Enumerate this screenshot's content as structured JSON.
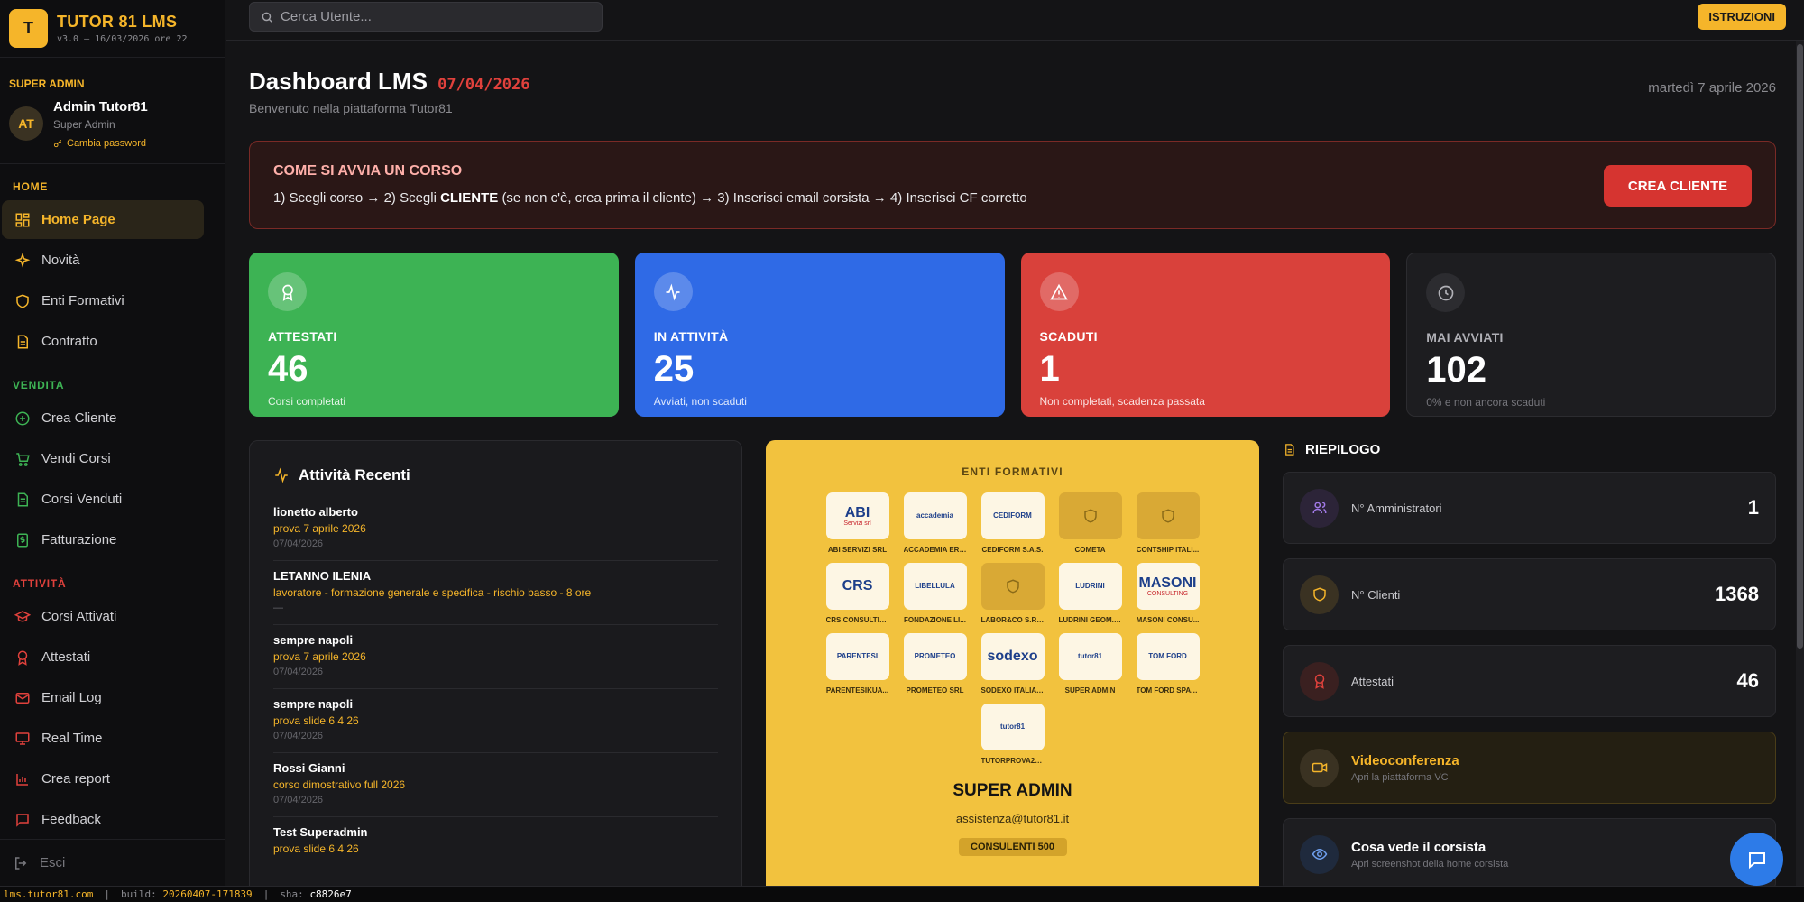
{
  "brand": {
    "logo_letter": "T",
    "name": "TUTOR 81 LMS",
    "version": "v3.0 — 16/03/2026 ore 22"
  },
  "user": {
    "role_heading": "SUPER ADMIN",
    "initials": "AT",
    "name": "Admin Tutor81",
    "role": "Super Admin",
    "change_password": "Cambia password"
  },
  "sidebar": {
    "sections": [
      {
        "label": "HOME",
        "color": "#f5b52a"
      },
      {
        "label": "VENDITA",
        "color": "#3db354"
      },
      {
        "label": "ATTIVITÀ",
        "color": "#e0413c"
      }
    ],
    "home_items": [
      {
        "label": "Home Page",
        "icon": "grid-icon"
      },
      {
        "label": "Novità",
        "icon": "sparkles-icon"
      },
      {
        "label": "Enti Formativi",
        "icon": "shield-icon"
      },
      {
        "label": "Contratto",
        "icon": "document-icon"
      }
    ],
    "vendita_items": [
      {
        "label": "Crea Cliente",
        "icon": "plus-circle-icon"
      },
      {
        "label": "Vendi Corsi",
        "icon": "cart-icon"
      },
      {
        "label": "Corsi Venduti",
        "icon": "sheet-icon"
      },
      {
        "label": "Fatturazione",
        "icon": "dollar-icon"
      }
    ],
    "attivita_items": [
      {
        "label": "Corsi Attivati",
        "icon": "graduation-cap-icon"
      },
      {
        "label": "Attestati",
        "icon": "award-icon"
      },
      {
        "label": "Email Log",
        "icon": "mail-icon"
      },
      {
        "label": "Real Time",
        "icon": "monitor-icon"
      },
      {
        "label": "Crea report",
        "icon": "bar-chart-icon"
      },
      {
        "label": "Feedback",
        "icon": "message-icon"
      }
    ],
    "exit_label": "Esci"
  },
  "topbar": {
    "search_placeholder": "Cerca Utente...",
    "instructions_label": "ISTRUZIONI"
  },
  "header": {
    "title": "Dashboard LMS",
    "date": "07/04/2026",
    "subtitle": "Benvenuto nella piattaforma Tutor81",
    "today": "martedì 7 aprile 2026"
  },
  "banner": {
    "title": "COME SI AVVIA UN CORSO",
    "step1": "1) Scegli corso",
    "step2_pre": "2) Scegli",
    "step2_bold": "CLIENTE",
    "step2_post": "(se non c'è, crea prima il cliente)",
    "step3": "3) Inserisci email corsista",
    "step4": "4) Inserisci CF corretto",
    "arrow": "→",
    "button": "CREA CLIENTE"
  },
  "stats": [
    {
      "label": "ATTESTATI",
      "value": "46",
      "desc": "Corsi completati",
      "color": "#3db354"
    },
    {
      "label": "IN ATTIVITÀ",
      "value": "25",
      "desc": "Avviati, non scaduti",
      "color": "#2f6ae6"
    },
    {
      "label": "SCADUTI",
      "value": "1",
      "desc": "Non completati, scadenza passata",
      "color": "#d9413b"
    },
    {
      "label": "MAI AVVIATI",
      "value": "102",
      "desc": "0% e non ancora scaduti",
      "color": "#1d1d20"
    }
  ],
  "activities": {
    "title": "Attività Recenti",
    "items": [
      {
        "name": "lionetto alberto",
        "course": "prova 7 aprile 2026",
        "date": "07/04/2026"
      },
      {
        "name": "LETANNO ILENIA",
        "course": "lavoratore - formazione generale e specifica - rischio basso - 8 ore",
        "date": "—"
      },
      {
        "name": "sempre napoli",
        "course": "prova 7 aprile 2026",
        "date": "07/04/2026"
      },
      {
        "name": "sempre napoli",
        "course": "prova slide 6 4 26",
        "date": "07/04/2026"
      },
      {
        "name": "Rossi Gianni",
        "course": "corso dimostrativo full 2026",
        "date": "07/04/2026"
      },
      {
        "name": "Test Superadmin",
        "course": "prova slide 6 4 26",
        "date": ""
      }
    ]
  },
  "enti": {
    "title": "ENTI FORMATIVI",
    "logos": [
      {
        "caption": "ABI SERVIZI SRL",
        "logo_text": "ABI",
        "logo_sub": "Servizi srl"
      },
      {
        "caption": "ACCADEMIA ERA...",
        "logo_text": "accademia",
        "logo_sub": ""
      },
      {
        "caption": "CEDIFORM S.A.S.",
        "logo_text": "CEDIFORM",
        "logo_sub": ""
      },
      {
        "caption": "COMETA",
        "logo_text": "",
        "logo_sub": ""
      },
      {
        "caption": "CONTSHIP ITALI...",
        "logo_text": "",
        "logo_sub": ""
      },
      {
        "caption": "CRS CONSULTIN...",
        "logo_text": "CRS",
        "logo_sub": ""
      },
      {
        "caption": "FONDAZIONE LI...",
        "logo_text": "LIBELLULA",
        "logo_sub": ""
      },
      {
        "caption": "LABOR&CO S.R.L.",
        "logo_text": "",
        "logo_sub": ""
      },
      {
        "caption": "LUDRINI GEOM. ...",
        "logo_text": "LUDRINI",
        "logo_sub": ""
      },
      {
        "caption": "MASONI CONSU...",
        "logo_text": "MASONI",
        "logo_sub": "CONSULTING"
      },
      {
        "caption": "PARENTESIKUA...",
        "logo_text": "PARENTESI",
        "logo_sub": ""
      },
      {
        "caption": "PROMETEO SRL",
        "logo_text": "PROMETEO",
        "logo_sub": ""
      },
      {
        "caption": "SODEXO ITALIA ...",
        "logo_text": "sodexo",
        "logo_sub": ""
      },
      {
        "caption": "SUPER ADMIN",
        "logo_text": "tutor81",
        "logo_sub": ""
      },
      {
        "caption": "TOM FORD SPA -...",
        "logo_text": "TOM FORD",
        "logo_sub": ""
      },
      {
        "caption": "TUTORPROVA20...",
        "logo_text": "tutor81",
        "logo_sub": ""
      }
    ],
    "admin_name": "SUPER ADMIN",
    "email": "assistenza@tutor81.it",
    "badge": "CONSULENTI 500"
  },
  "summary": {
    "title": "RIEPILOGO",
    "rows": [
      {
        "label": "N° Amministratori",
        "value": "1",
        "icon": "users-icon",
        "color": "#a27ae8"
      },
      {
        "label": "N° Clienti",
        "value": "1368",
        "icon": "shield-icon",
        "color": "#f5b52a"
      },
      {
        "label": "Attestati",
        "value": "46",
        "icon": "award-icon",
        "color": "#e0413c"
      }
    ],
    "links": [
      {
        "title": "Videoconferenza",
        "subtitle": "Apri la piattaforma VC",
        "icon": "video-icon"
      },
      {
        "title": "Cosa vede il corsista",
        "subtitle": "Apri screenshot della home corsista",
        "icon": "eye-icon"
      }
    ]
  },
  "statusbar": {
    "host": "lms.tutor81.com",
    "build_label": "build:",
    "build": "20260407-171839",
    "sha_label": "sha:",
    "sha": "c8826e7"
  }
}
